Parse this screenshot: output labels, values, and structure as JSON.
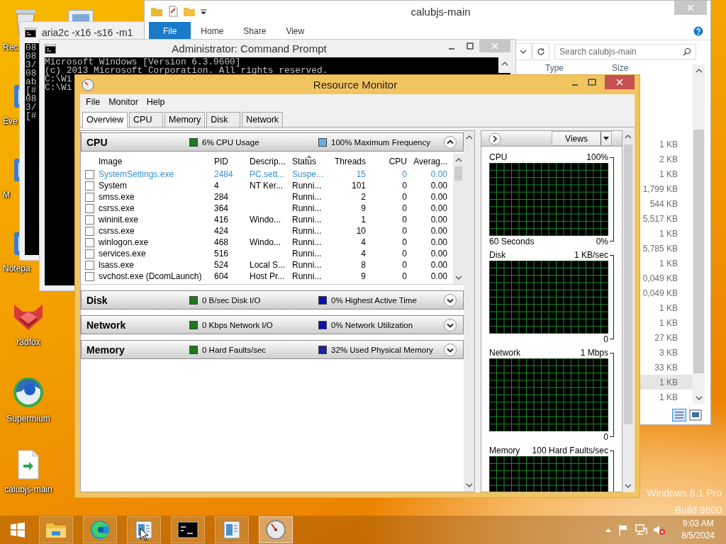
{
  "desktop": {
    "icons": [
      {
        "kind": "recycle-bin",
        "label": "Rec"
      },
      {
        "kind": "app",
        "label": "Eve"
      },
      {
        "kind": "app",
        "label": "M"
      },
      {
        "kind": "app",
        "label": "Notepa"
      },
      {
        "kind": "fox",
        "label": "r3dfox"
      },
      {
        "kind": "globe",
        "label": "Supermium"
      },
      {
        "kind": "file",
        "label": "calubjs-main"
      }
    ],
    "edition_text": [
      "Windows 8.1 Pro",
      "Build 9600"
    ]
  },
  "explorer": {
    "title": "calubjs-main",
    "ribbon_tabs": [
      {
        "label": "File",
        "selected": true
      },
      {
        "label": "Home",
        "selected": false
      },
      {
        "label": "Share",
        "selected": false
      },
      {
        "label": "View",
        "selected": false
      }
    ],
    "search": {
      "placeholder": "Search calubjs-main"
    },
    "columns": [
      "Type",
      "Size"
    ],
    "rows": [
      {
        "size": "1 KB",
        "selected": false
      },
      {
        "size": "2 KB",
        "selected": false
      },
      {
        "size": "1 KB",
        "selected": false
      },
      {
        "size": "1,799 KB",
        "selected": false
      },
      {
        "size": "544 KB",
        "selected": false
      },
      {
        "size": "5,517 KB",
        "selected": false
      },
      {
        "size": "1 KB",
        "selected": false
      },
      {
        "size": "5,785 KB",
        "selected": false
      },
      {
        "size": "1 KB",
        "selected": false
      },
      {
        "size": "0,049 KB",
        "selected": false
      },
      {
        "size": "0,049 KB",
        "selected": false
      },
      {
        "size": "1 KB",
        "selected": false
      },
      {
        "size": "1 KB",
        "selected": false
      },
      {
        "size": "27 KB",
        "selected": false
      },
      {
        "size": "3 KB",
        "selected": false
      },
      {
        "size": "33 KB",
        "selected": false
      },
      {
        "size": "1 KB",
        "selected": true
      },
      {
        "size": "1 KB",
        "selected": false
      }
    ]
  },
  "aria2c_window": {
    "title": "aria2c  -x16 -s16 -m1",
    "lines": [
      "08",
      "08",
      "3/",
      "08",
      "ab",
      "[#",
      "08",
      "3/",
      "[#"
    ]
  },
  "command_prompt": {
    "title": "Administrator: Command Prompt",
    "lines": [
      "Microsoft Windows [Version 6.3.9600]",
      "(c) 2013 Microsoft Corporation. All rights reserved.",
      "C:\\Wi",
      "C:\\Wi"
    ]
  },
  "resource_monitor": {
    "title": "Resource Monitor",
    "menu": [
      "File",
      "Monitor",
      "Help"
    ],
    "tabs": [
      {
        "label": "Overview",
        "selected": true
      },
      {
        "label": "CPU",
        "selected": false
      },
      {
        "label": "Memory",
        "selected": false
      },
      {
        "label": "Disk",
        "selected": false
      },
      {
        "label": "Network",
        "selected": false
      }
    ],
    "sections": [
      {
        "title": "CPU",
        "expanded": true,
        "legend": [
          {
            "text": "6% CPU Usage",
            "color": "#1e7a1e"
          },
          {
            "text": "100% Maximum Frequency",
            "color": "#6aaee8"
          }
        ],
        "table": {
          "columns": [
            {
              "label": "Image",
              "sorted": false
            },
            {
              "label": "PID",
              "sorted": false
            },
            {
              "label": "Descrip...",
              "sorted": false
            },
            {
              "label": "Status",
              "sorted": true
            },
            {
              "label": "Threads",
              "sorted": false
            },
            {
              "label": "CPU",
              "sorted": false
            },
            {
              "label": "Averag...",
              "sorted": false
            }
          ],
          "rows": [
            {
              "checked": false,
              "suspended": true,
              "image": "SystemSettings.exe",
              "pid": "2484",
              "description": "PC.sett...",
              "status": "Suspe...",
              "threads": "15",
              "cpu": "0",
              "average": "0.00"
            },
            {
              "checked": false,
              "suspended": false,
              "image": "System",
              "pid": "4",
              "description": "NT Ker...",
              "status": "Runni...",
              "threads": "101",
              "cpu": "0",
              "average": "0.00"
            },
            {
              "checked": false,
              "suspended": false,
              "image": "smss.exe",
              "pid": "284",
              "status": "Runni...",
              "threads": "2",
              "cpu": "0",
              "average": "0.00"
            },
            {
              "checked": false,
              "suspended": false,
              "image": "csrss.exe",
              "pid": "364",
              "status": "Runni...",
              "threads": "9",
              "cpu": "0",
              "average": "0.00"
            },
            {
              "checked": false,
              "suspended": false,
              "image": "wininit.exe",
              "pid": "416",
              "description": "Windo...",
              "status": "Runni...",
              "threads": "1",
              "cpu": "0",
              "average": "0.00"
            },
            {
              "checked": false,
              "suspended": false,
              "image": "csrss.exe",
              "pid": "424",
              "status": "Runni...",
              "threads": "10",
              "cpu": "0",
              "average": "0.00"
            },
            {
              "checked": false,
              "suspended": false,
              "image": "winlogon.exe",
              "pid": "468",
              "description": "Windo...",
              "status": "Runni...",
              "threads": "4",
              "cpu": "0",
              "average": "0.00"
            },
            {
              "checked": false,
              "suspended": false,
              "image": "services.exe",
              "pid": "516",
              "status": "Runni...",
              "threads": "4",
              "cpu": "0",
              "average": "0.00"
            },
            {
              "checked": false,
              "suspended": false,
              "image": "lsass.exe",
              "pid": "524",
              "description": "Local S...",
              "status": "Runni...",
              "threads": "8",
              "cpu": "0",
              "average": "0.00"
            },
            {
              "checked": false,
              "suspended": false,
              "image": "svchost.exe (DcomLaunch)",
              "pid": "604",
              "description": "Host Pr...",
              "status": "Runni...",
              "threads": "9",
              "cpu": "0",
              "average": "0.00"
            }
          ]
        }
      },
      {
        "title": "Disk",
        "expanded": false,
        "legend": [
          {
            "text": "0 B/sec Disk I/O",
            "color": "#1e7a1e"
          },
          {
            "text": "0% Highest Active Time",
            "color": "#1010b0"
          }
        ]
      },
      {
        "title": "Network",
        "expanded": false,
        "legend": [
          {
            "text": "0 Kbps Network I/O",
            "color": "#1e7a1e"
          },
          {
            "text": "0% Network Utilization",
            "color": "#1010b0"
          }
        ]
      },
      {
        "title": "Memory",
        "expanded": false,
        "legend": [
          {
            "text": "0 Hard Faults/sec",
            "color": "#1e7a1e"
          },
          {
            "text": "32% Used Physical Memory",
            "color": "#2020a0"
          }
        ]
      }
    ],
    "graph_panel": {
      "views_button": "Views",
      "graphs": [
        {
          "title": "CPU",
          "max": "100%",
          "time_span": "60 Seconds",
          "min": "0%"
        },
        {
          "title": "Disk",
          "max": "1 KB/sec",
          "min": "0"
        },
        {
          "title": "Network",
          "max": "1 Mbps",
          "min": "0"
        },
        {
          "title": "Memory",
          "max": "100 Hard Faults/sec"
        }
      ]
    }
  },
  "taskbar": {
    "buttons": [
      {
        "kind": "folder",
        "selected": false
      },
      {
        "kind": "edge",
        "selected": false
      },
      {
        "kind": "document",
        "selected": false
      },
      {
        "kind": "console",
        "selected": false
      },
      {
        "kind": "document",
        "selected": false
      },
      {
        "kind": "gauge",
        "selected": true
      }
    ],
    "clock": {
      "time": "9:03 AM",
      "date": "8/5/2024"
    }
  }
}
